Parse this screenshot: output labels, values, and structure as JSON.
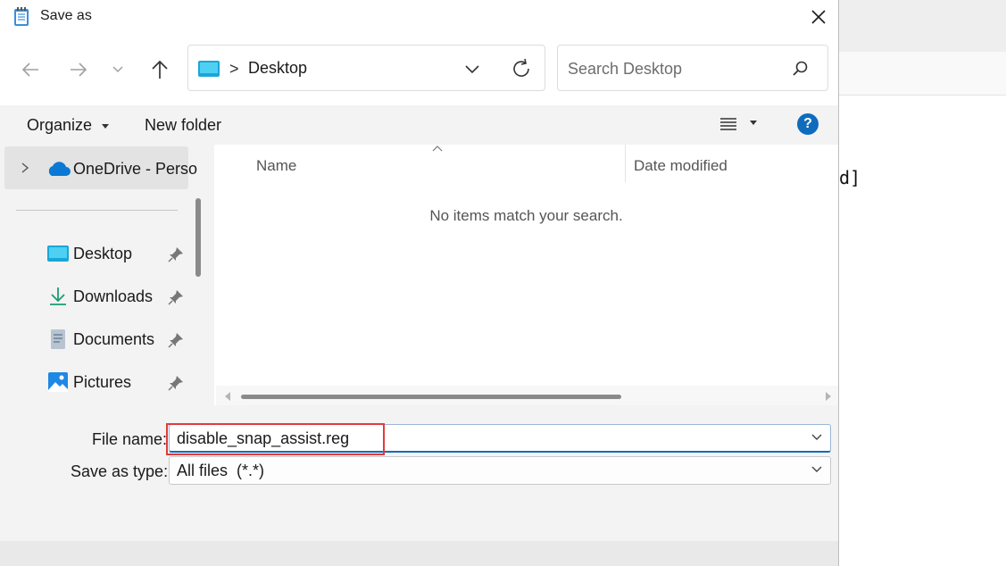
{
  "dialog": {
    "title": "Save as",
    "nav": {
      "address": {
        "current": "Desktop",
        "separator": ">"
      },
      "search_placeholder": "Search Desktop"
    },
    "command_bar": {
      "organize": "Organize",
      "new_folder": "New folder",
      "help": "?"
    },
    "nav_pane": {
      "onedrive": "OneDrive - Perso",
      "items": [
        {
          "label": "Desktop",
          "icon": "desktop-folder-icon"
        },
        {
          "label": "Downloads",
          "icon": "download-icon"
        },
        {
          "label": "Documents",
          "icon": "documents-icon"
        },
        {
          "label": "Pictures",
          "icon": "pictures-icon"
        }
      ]
    },
    "file_list": {
      "columns": [
        "Name",
        "Date modified"
      ],
      "empty_message": "No items match your search."
    },
    "file_name": {
      "label": "File name:",
      "value": "disable_snap_assist.reg"
    },
    "save_as_type": {
      "label": "Save as type:",
      "value": "All files  (*.*)"
    },
    "colors": {
      "accent": "#0f6cbd",
      "highlight_box": "#e23b3b",
      "onedrive": "#0a78d4"
    }
  },
  "background_window": {
    "visible_text": "d]"
  }
}
